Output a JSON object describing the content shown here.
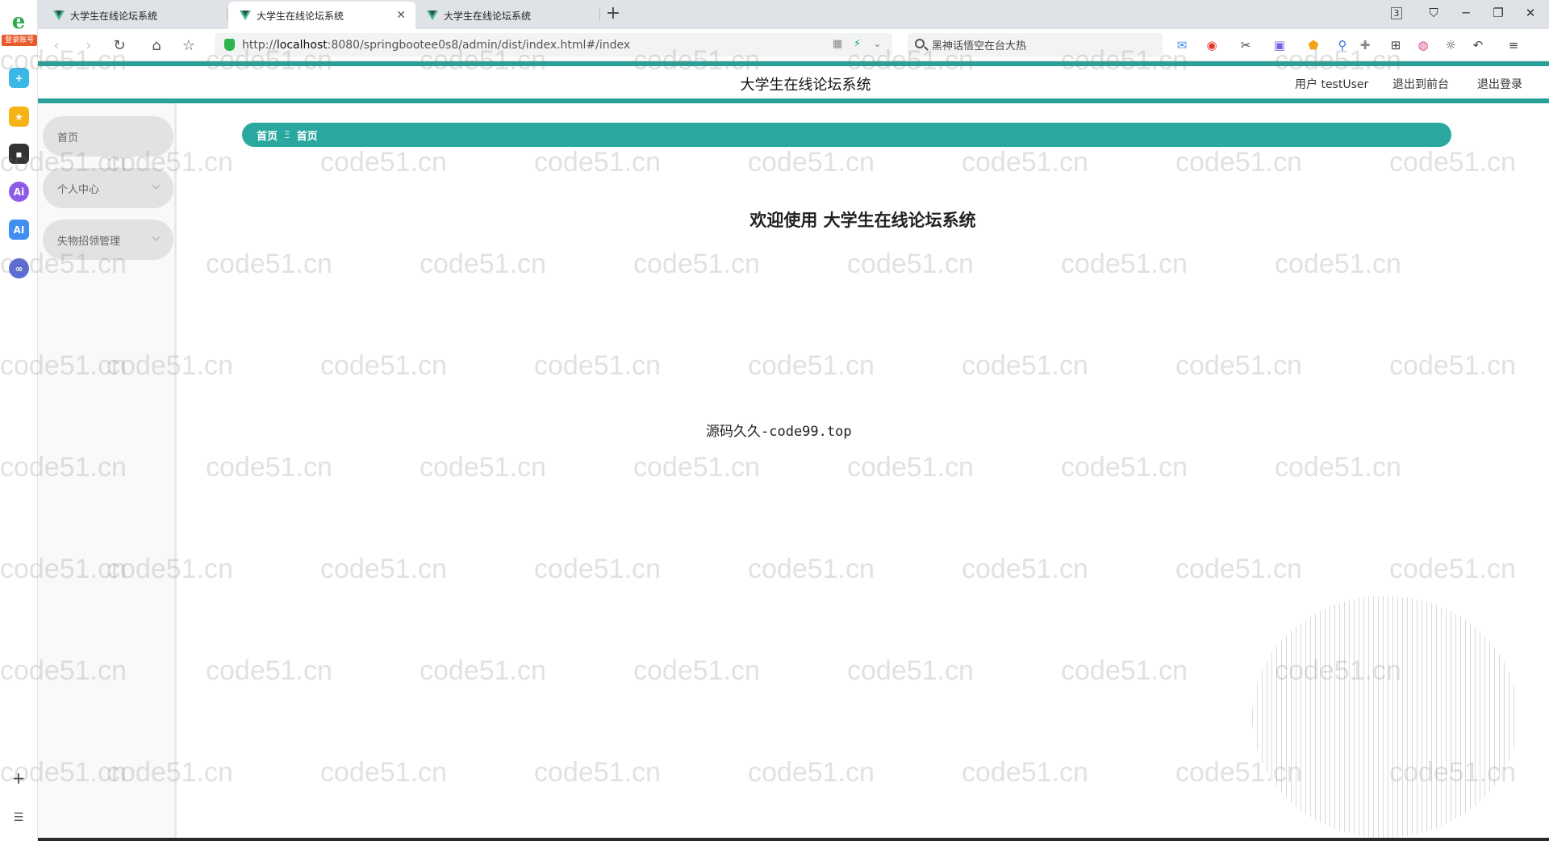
{
  "browser": {
    "tabs": [
      {
        "title": "大学生在线论坛系统",
        "active": false
      },
      {
        "title": "大学生在线论坛系统",
        "active": true
      },
      {
        "title": "大学生在线论坛系统",
        "active": false
      }
    ],
    "new_tab": "+",
    "tab_count": "3",
    "url_prefix": "http://",
    "url_host": "localhost",
    "url_rest": ":8080/springbootee0s8/admin/dist/index.html#/index",
    "search_text": "黑神话悟空在台大热",
    "side_badge": "登录账号",
    "colors": {
      "accent": "#2aa198",
      "lock": "#2fb34a"
    }
  },
  "app": {
    "title": "大学生在线论坛系统",
    "user_label": "用户 testUser",
    "front_link": "退出到前台",
    "logout_link": "退出登录"
  },
  "menu": {
    "items": [
      {
        "label": "首页"
      },
      {
        "label": "个人中心"
      },
      {
        "label": "失物招领管理"
      }
    ]
  },
  "breadcrumb": {
    "home": "首页",
    "separator": "Ξ",
    "current": "首页"
  },
  "main": {
    "welcome": "欢迎使用 大学生在线论坛系统",
    "source": "源码久久-code99.top"
  },
  "watermark": {
    "text": "code51.cn"
  }
}
